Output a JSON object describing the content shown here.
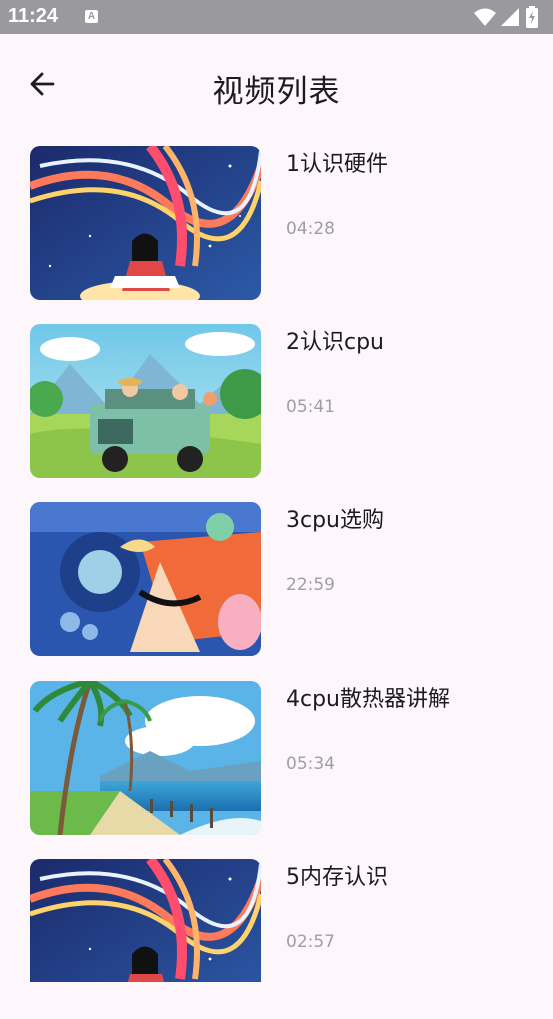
{
  "status_bar": {
    "time": "11:24",
    "notification_badge": "A",
    "icons": [
      "wifi-icon",
      "signal-icon",
      "battery-icon"
    ]
  },
  "app_bar": {
    "back_icon": "arrow-left-icon",
    "title": "视频列表"
  },
  "videos": [
    {
      "title": "1认识硬件",
      "duration": "04:28",
      "thumbnail": "girl-reading-book-magic-swirl"
    },
    {
      "title": "2认识cpu",
      "duration": "05:41",
      "thumbnail": "jeep-in-meadow-mountains"
    },
    {
      "title": "3cpu选购",
      "duration": "22:59",
      "thumbnail": "abstract-bird-shapes"
    },
    {
      "title": "4cpu散热器讲解",
      "duration": "05:34",
      "thumbnail": "palm-trees-beach"
    },
    {
      "title": "5内存认识",
      "duration": "02:57",
      "thumbnail": "girl-reading-book-magic-swirl"
    }
  ],
  "colors": {
    "background": "#fdf7fc",
    "status_bar": "#9a9a9e",
    "title_text": "#1c1b1f",
    "secondary_text": "#9e9ea3"
  }
}
